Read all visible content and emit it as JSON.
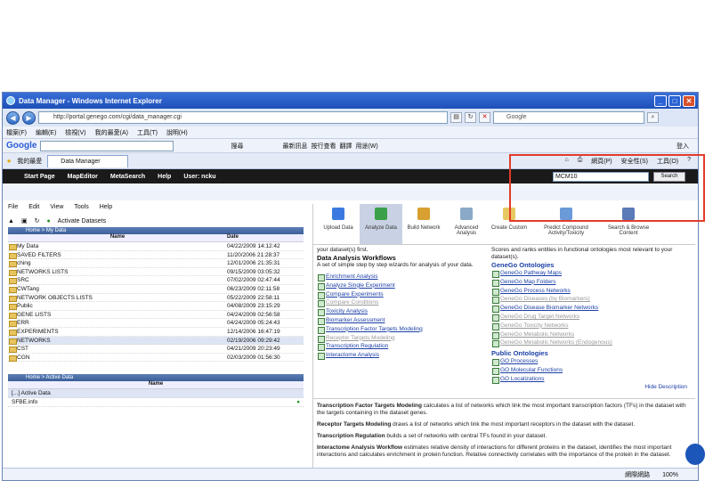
{
  "window": {
    "title": "Data Manager - Windows Internet Explorer",
    "url": "http://portal.genego.com/cgi/data_manager.cgi",
    "search_engine": "Google"
  },
  "ie_menu": [
    "檔案(F)",
    "編輯(E)",
    "檢視(V)",
    "我的最愛(A)",
    "工具(T)",
    "說明(H)"
  ],
  "google_bar": {
    "logo": "Google",
    "items": [
      "搜尋",
      "最新訊息",
      "按行查看",
      "翻譯",
      "用途(W)"
    ],
    "right": [
      "登入"
    ]
  },
  "tabs": {
    "favorites": "我的最愛",
    "active": "Data Manager",
    "cmds": [
      "網頁(P)",
      "安全性(S)",
      "工具(O)"
    ]
  },
  "dm_toolbar": [
    "Start Page",
    "MapEditor",
    "MetaSearch",
    "Help",
    "User: ncku"
  ],
  "top_search": {
    "value": "MCM10",
    "button": "Search"
  },
  "left": {
    "menu": [
      "File",
      "Edit",
      "View",
      "Tools",
      "Help"
    ],
    "toolbar_hint": "Activate Datasets",
    "home_bar": "Home > My Data",
    "columns": {
      "name": "Name",
      "date": "Date"
    },
    "files": [
      {
        "name": "My Data",
        "date": "04/22/2009 14:12:42"
      },
      {
        "name": "SAVED FILTERS",
        "date": "11/20/2006 21:28:37"
      },
      {
        "name": "ching",
        "date": "12/01/2006 21:35:31"
      },
      {
        "name": "NETWORKS LISTS",
        "date": "09/15/2009 03:05:32"
      },
      {
        "name": "SRC",
        "date": "07/02/2009 02:47:44"
      },
      {
        "name": "CWTang",
        "date": "06/23/2009 02:11:58"
      },
      {
        "name": "NETWORK OBJECTS LISTS",
        "date": "05/22/2009 22:58:11"
      },
      {
        "name": "Public",
        "date": "04/08/2009 23:15:29"
      },
      {
        "name": "GENE LISTS",
        "date": "04/24/2009 02:56:58"
      },
      {
        "name": "ERR",
        "date": "04/24/2009 05:24:43"
      },
      {
        "name": "EXPERIMENTS",
        "date": "12/14/2006 16:47:19"
      },
      {
        "name": "NETWORKS",
        "date": "02/19/2006 09:29:42"
      },
      {
        "name": "CST",
        "date": "04/21/2009 20:23:49"
      },
      {
        "name": "CGN",
        "date": "02/03/2009 01:56:30"
      }
    ],
    "active_bar": "Home > Active Data",
    "active_col": "Name",
    "active_rows": [
      "[...] Active Data",
      "SFBE.info"
    ]
  },
  "right": {
    "tools": [
      "Upload Data",
      "Analyze Data",
      "Build Network",
      "Advanced Analysis",
      "Create Custom",
      "Predict Compound Activity/Toxicity",
      "Search & Browse Content"
    ],
    "intro": "your dataset(s) first.",
    "daw_title": "Data Analysis Workflows",
    "daw_desc": "A set of simple step by step wizards for analysis of your data.",
    "workflows": [
      "Enrichment Analysis",
      "Analyze Single Experiment",
      "Compare Experiments",
      "Compare Conditions",
      "Toxicity Analysis",
      "Biomarker Assessment",
      "Transcription Factor Targets Modeling",
      "Receptor Targets Modeling",
      "Transcription Regulation",
      "Interactome Analysis"
    ],
    "onto_desc": "Scores and ranks entities in functional ontologies most relevant to your dataset(s).",
    "gg_title": "GeneGo Ontologies",
    "gg_items": [
      "GeneGo Pathway Maps",
      "GeneGo Map Folders",
      "GeneGo Process Networks",
      "GeneGo Diseases (by Biomarkers)",
      "GeneGo Disease Biomarker Networks",
      "GeneGo Drug Target Networks",
      "GeneGo Toxicity Networks",
      "GeneGo Metabolic Networks",
      "GeneGo Metabolic Networks (Endogenous)"
    ],
    "pub_title": "Public Ontologies",
    "pub_items": [
      "GO Processes",
      "GO Molecular Functions",
      "GO Localizations"
    ],
    "hide_desc": "Hide Description",
    "descs": [
      {
        "title": "Transcription Factor Targets Modeling",
        "text": " calculates a list of networks which link the most important transcription factors (TFs) in the dataset with the targets containing in the dataset genes."
      },
      {
        "title": "Receptor Targets Modeling",
        "text": " draws a list of networks which link the most important receptors in the dataset with the dataset."
      },
      {
        "title": "Transcription Regulation",
        "text": " builds a set of networks with central TFs found in your dataset."
      },
      {
        "title": "Interactome Analysis Workflow",
        "text": " estimates relative density of interactions for different proteins in the dataset, identifies the most important interactions and calculates enrichment in protein function. Relative connectivity correlates with the importance of the protein in the dataset."
      }
    ]
  },
  "status": {
    "zone": "網際網路",
    "zoom": "100%"
  }
}
